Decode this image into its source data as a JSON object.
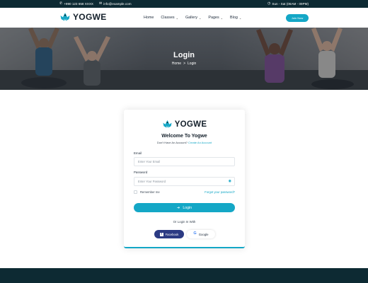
{
  "topbar": {
    "phone": "+990 123 658 XXXX",
    "email": "info@example.com",
    "hours": "Sun - Sat (06AM - 09PM)",
    "phone_icon": "phone-icon",
    "email_icon": "mail-icon",
    "clock_icon": "clock-icon"
  },
  "brand": {
    "name": "YOGWE",
    "logo_icon": "lotus-icon",
    "accent": "#14a7c6",
    "dark": "#0d2a33"
  },
  "nav": {
    "items": [
      {
        "label": "Home",
        "dropdown": false
      },
      {
        "label": "Classes",
        "dropdown": true
      },
      {
        "label": "Gallery",
        "dropdown": true
      },
      {
        "label": "Pages",
        "dropdown": true
      },
      {
        "label": "Blog",
        "dropdown": true
      }
    ],
    "cta": "Join Now"
  },
  "hero": {
    "title": "Login",
    "breadcrumb": {
      "home": "Home",
      "separator": ">",
      "current": "Login"
    }
  },
  "login": {
    "brand": "YOGWE",
    "title": "Welcome To Yogwe",
    "subtitle": "Don't Have An Account?",
    "create_link": "Create An Account",
    "email_label": "Email",
    "email_placeholder": "Enter Your Email",
    "password_label": "Password",
    "password_placeholder": "Enter Your Password",
    "remember": "Remember me",
    "forgot": "Forgot your password?",
    "submit": "Login",
    "divider": "Or Login In With",
    "facebook": "Facebook",
    "google": "Google"
  }
}
